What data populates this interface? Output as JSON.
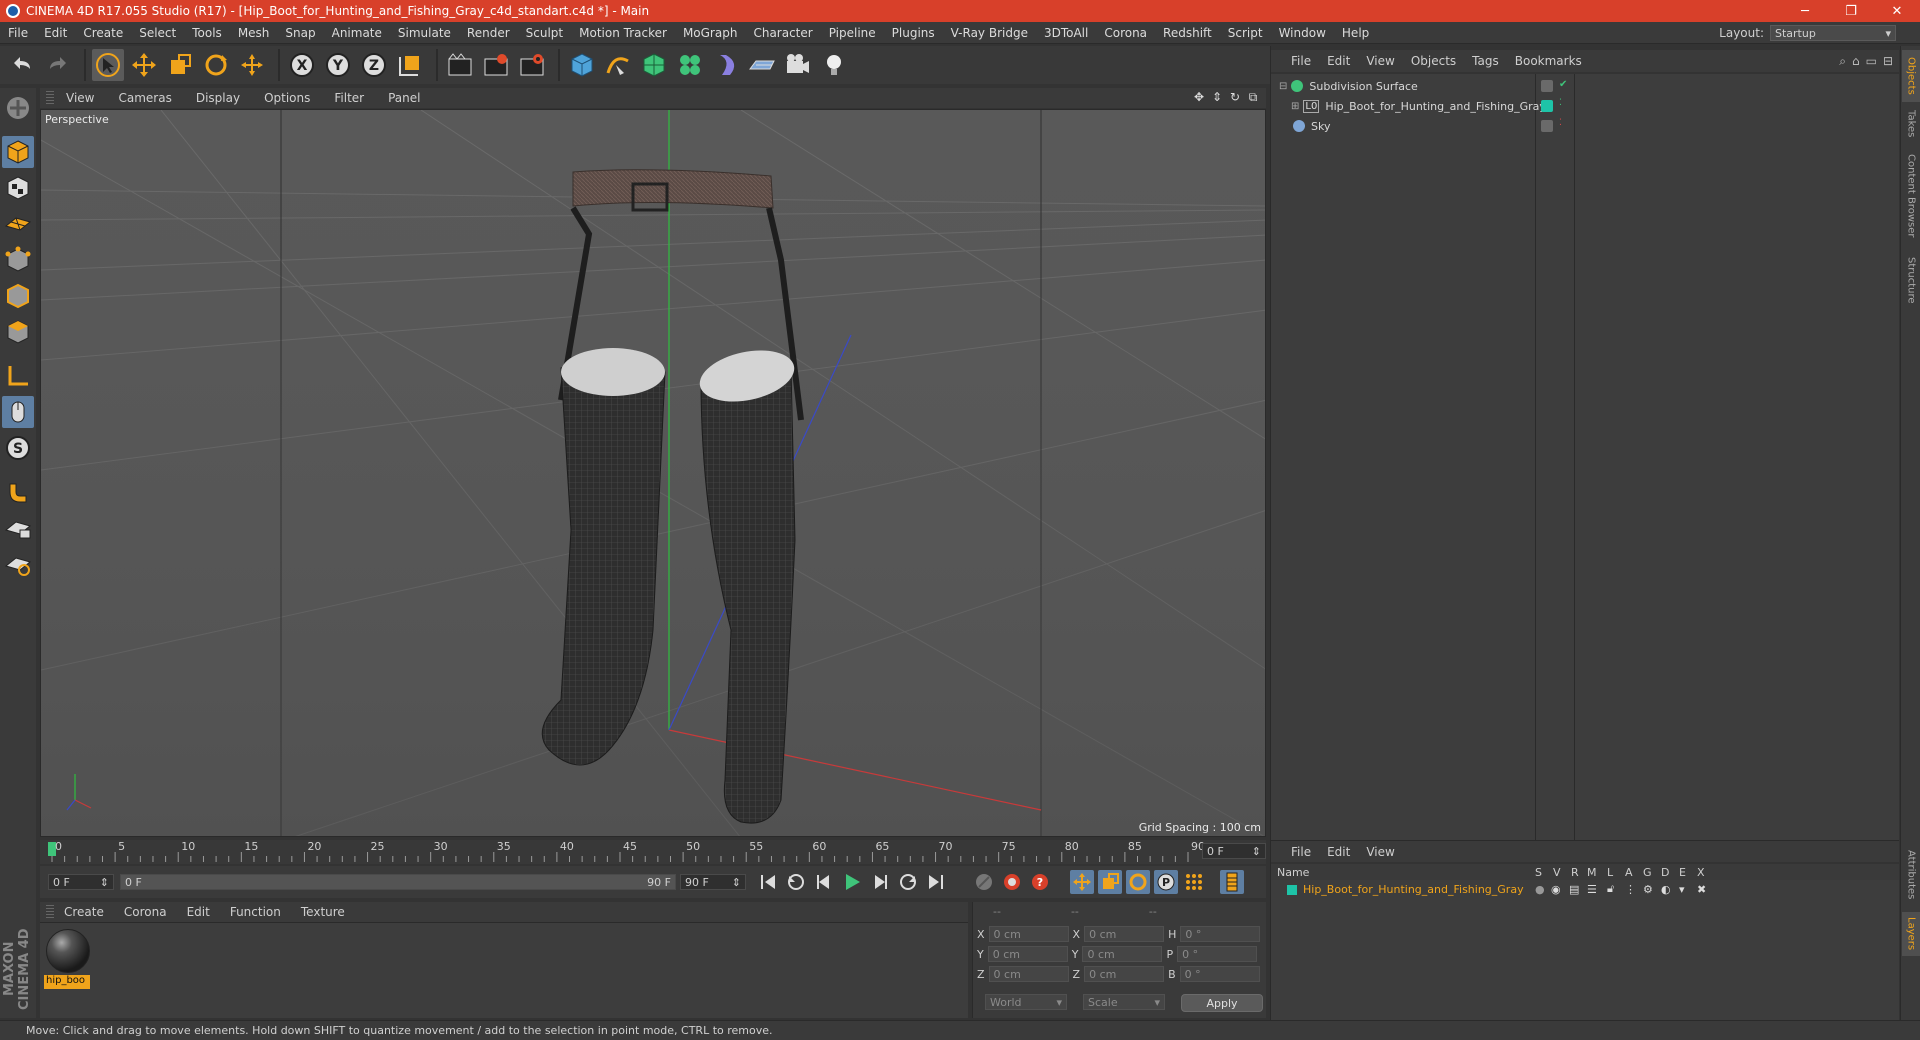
{
  "window": {
    "title": "CINEMA 4D R17.055 Studio (R17) - [Hip_Boot_for_Hunting_and_Fishing_Gray_c4d_standart.c4d *] - Main",
    "buttons": [
      "─",
      "❐",
      "✕"
    ]
  },
  "menubar": {
    "items": [
      "File",
      "Edit",
      "Create",
      "Select",
      "Tools",
      "Mesh",
      "Snap",
      "Animate",
      "Simulate",
      "Render",
      "Sculpt",
      "Motion Tracker",
      "MoGraph",
      "Character",
      "Pipeline",
      "Plugins",
      "V-Ray Bridge",
      "3DToAll",
      "Corona",
      "Redshift",
      "Script",
      "Window",
      "Help"
    ],
    "layout_label": "Layout:",
    "layout_value": "Startup"
  },
  "toolbar": {
    "icons": [
      "undo-icon",
      "redo-icon",
      "live-selection-icon",
      "move-icon",
      "scale-icon",
      "rotate-icon",
      "transform-icon",
      "x-axis-icon",
      "y-axis-icon",
      "z-axis-icon",
      "coordinate-system-icon",
      "render-view-icon",
      "render-picture-viewer-icon",
      "edit-render-settings-icon",
      "cube-icon",
      "pen-spline-icon",
      "subdivision-icon",
      "cloner-icon",
      "deformer-icon",
      "floor-icon",
      "camera-icon",
      "light-icon"
    ]
  },
  "viewport": {
    "menu": [
      "View",
      "Cameras",
      "Display",
      "Options",
      "Filter",
      "Panel"
    ],
    "label": "Perspective",
    "grid_spacing": "Grid Spacing : 100 cm"
  },
  "timeline": {
    "ticks": [
      "0",
      "5",
      "10",
      "15",
      "20",
      "25",
      "30",
      "35",
      "40",
      "45",
      "50",
      "55",
      "60",
      "65",
      "70",
      "75",
      "80",
      "85",
      "90"
    ],
    "current_frame": "0 F",
    "start_frame": "0 F",
    "range_start": "0 F",
    "range_end": "90 F",
    "end_frame": "90 F"
  },
  "material_manager": {
    "menu": [
      "Create",
      "Corona",
      "Edit",
      "Function",
      "Texture"
    ],
    "material_name": "hip_boo"
  },
  "coordinates": {
    "headers": [
      "--",
      "--",
      "--"
    ],
    "rows": [
      {
        "axis": "X",
        "pos": "0 cm",
        "axis2": "X",
        "size": "0 cm",
        "rot_label": "H",
        "rot": "0 °"
      },
      {
        "axis": "Y",
        "pos": "0 cm",
        "axis2": "Y",
        "size": "0 cm",
        "rot_label": "P",
        "rot": "0 °"
      },
      {
        "axis": "Z",
        "pos": "0 cm",
        "axis2": "Z",
        "size": "0 cm",
        "rot_label": "B",
        "rot": "0 °"
      }
    ],
    "space": "World",
    "mode": "Scale",
    "apply": "Apply"
  },
  "object_manager": {
    "menu": [
      "File",
      "Edit",
      "View",
      "Objects",
      "Tags",
      "Bookmarks"
    ],
    "objects": [
      {
        "name": "Subdivision Surface",
        "icon_color": "#3fc47a",
        "indent": 0
      },
      {
        "name": "Hip_Boot_for_Hunting_and_Fishing_Gray",
        "icon_color": "#9a9a9a",
        "indent": 1
      },
      {
        "name": "Sky",
        "icon_color": "#7fa6d6",
        "indent": 0
      }
    ]
  },
  "layer_manager": {
    "menu": [
      "File",
      "Edit",
      "View"
    ],
    "columns": [
      "Name",
      "S",
      "V",
      "R",
      "M",
      "L",
      "A",
      "G",
      "D",
      "E",
      "X"
    ],
    "layer_name": "Hip_Boot_for_Hunting_and_Fishing_Gray",
    "layer_color": "#1ec4a8"
  },
  "side_tabs": [
    "Objects",
    "Takes",
    "Content Browser",
    "Structure",
    "Attributes",
    "Layers"
  ],
  "status": {
    "text": "Move: Click and drag to move elements. Hold down SHIFT to quantize movement / add to the selection in point mode, CTRL to remove."
  },
  "branding": {
    "logo": "MAXON CINEMA 4D"
  },
  "colors": {
    "accent": "#f0a41b",
    "titlebar": "#d8402a",
    "selection": "#5e7fa3"
  }
}
